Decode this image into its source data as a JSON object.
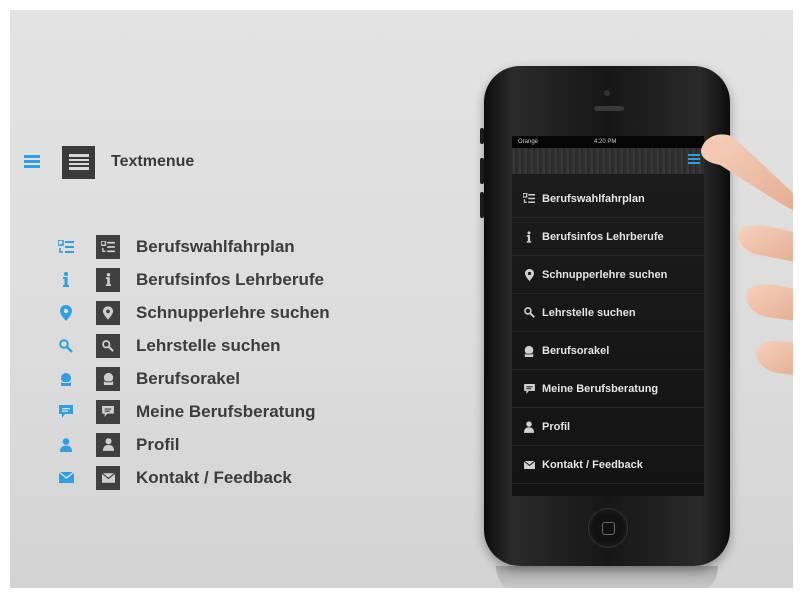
{
  "legend": {
    "title": "Textmenue",
    "items": [
      {
        "icon": "route-plan-icon",
        "label": "Berufswahlfahrplan"
      },
      {
        "icon": "info-icon",
        "label": "Berufsinfos Lehrberufe"
      },
      {
        "icon": "location-pin-icon",
        "label": "Schnupperlehre suchen"
      },
      {
        "icon": "search-icon",
        "label": "Lehrstelle suchen"
      },
      {
        "icon": "oracle-icon",
        "label": "Berufsorakel"
      },
      {
        "icon": "speech-bubble-icon",
        "label": "Meine Berufsberatung"
      },
      {
        "icon": "person-icon",
        "label": "Profil"
      },
      {
        "icon": "envelope-icon",
        "label": "Kontakt / Feedback"
      }
    ]
  },
  "phone": {
    "carrier": "Orange",
    "time": "4:20 PM",
    "menu": [
      {
        "icon": "route-plan-icon",
        "label": "Berufswahlfahrplan"
      },
      {
        "icon": "info-icon",
        "label": "Berufsinfos Lehrberufe"
      },
      {
        "icon": "location-pin-icon",
        "label": "Schnupperlehre suchen"
      },
      {
        "icon": "search-icon",
        "label": "Lehrstelle suchen"
      },
      {
        "icon": "oracle-icon",
        "label": "Berufsorakel"
      },
      {
        "icon": "speech-bubble-icon",
        "label": "Meine Berufsberatung"
      },
      {
        "icon": "person-icon",
        "label": "Profil"
      },
      {
        "icon": "envelope-icon",
        "label": "Kontakt / Feedback"
      }
    ]
  },
  "colors": {
    "accent": "#2ea0e0",
    "legend_text": "#3c3c3c",
    "icon_box": "#3f3f3f",
    "phone_text": "#e4e4e4"
  }
}
